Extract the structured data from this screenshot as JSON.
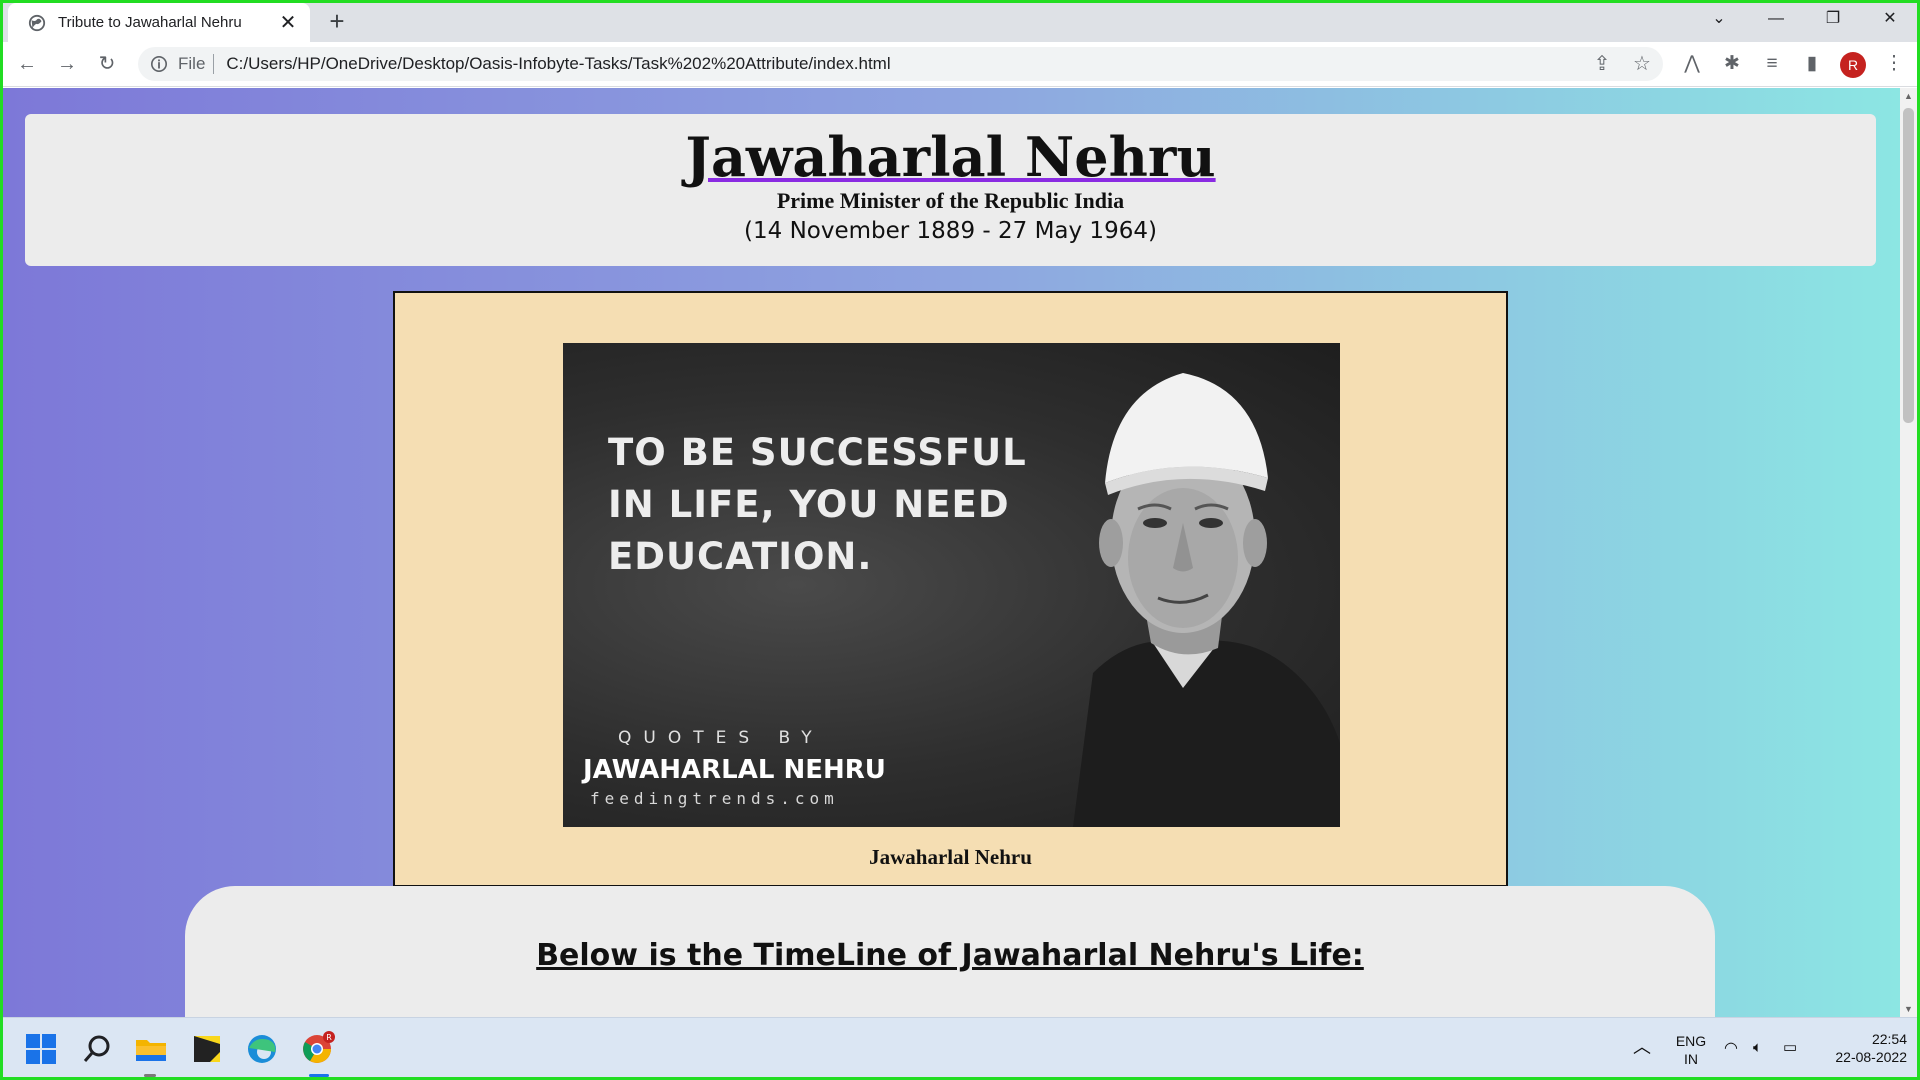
{
  "browser": {
    "tab_title": "Tribute to Jawaharlal Nehru",
    "tab_close": "✕",
    "new_tab": "+",
    "url_scheme": "File",
    "url": "C:/Users/HP/OneDrive/Desktop/Oasis-Infobyte-Tasks/Task%202%20Attribute/index.html",
    "profile_initial": "R"
  },
  "page": {
    "title": "Jawaharlal Nehru",
    "subtitle": "Prime Minister of the Republic India",
    "dates": "(14 November 1889 - 27 May 1964)",
    "image": {
      "quote": [
        "TO BE SUCCESSFUL",
        "IN LIFE, YOU NEED",
        "EDUCATION."
      ],
      "quotes_by": "QUOTES BY",
      "name": "JAWAHARLAL NEHRU",
      "site": "feedingtrends.com"
    },
    "caption": "Jawaharlal Nehru",
    "timeline_heading": "Below is the TimeLine of Jawaharlal Nehru's Life:"
  },
  "taskbar": {
    "lang_line1": "ENG",
    "lang_line2": "IN",
    "time": "22:54",
    "date": "22-08-2022",
    "chrome_badge": "R"
  },
  "colors": {
    "page_gradient_start": "#7d78d8",
    "page_gradient_end": "#8ce6e3",
    "figure_bg": "#f5deb3",
    "title_underline": "#8a2be2",
    "window_border": "#22dd22"
  }
}
